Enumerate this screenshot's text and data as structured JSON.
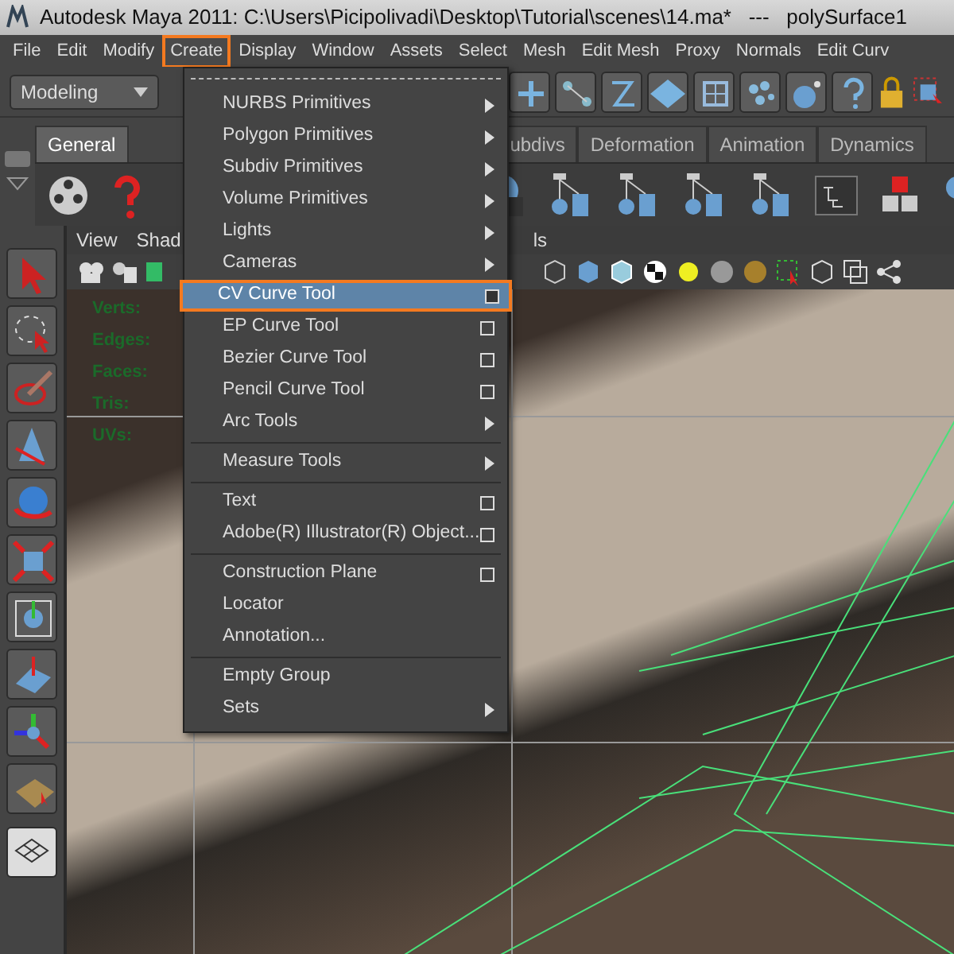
{
  "window": {
    "title": "Autodesk Maya 2011: C:\\Users\\Picipolivadi\\Desktop\\Tutorial\\scenes\\14.ma*   ---   polySurface1"
  },
  "menu_bar": [
    {
      "label": "File",
      "selected": false
    },
    {
      "label": "Edit",
      "selected": false
    },
    {
      "label": "Modify",
      "selected": false
    },
    {
      "label": "Create",
      "selected": true
    },
    {
      "label": "Display",
      "selected": false
    },
    {
      "label": "Window",
      "selected": false
    },
    {
      "label": "Assets",
      "selected": false
    },
    {
      "label": "Select",
      "selected": false
    },
    {
      "label": "Mesh",
      "selected": false
    },
    {
      "label": "Edit Mesh",
      "selected": false
    },
    {
      "label": "Proxy",
      "selected": false
    },
    {
      "label": "Normals",
      "selected": false
    },
    {
      "label": "Edit Curv",
      "selected": false
    }
  ],
  "status_line": {
    "menu_set": "Modeling"
  },
  "shelf_tabs": [
    {
      "label": "General",
      "selected": true
    },
    {
      "label": "ubdivs",
      "selected": false
    },
    {
      "label": "Deformation",
      "selected": false
    },
    {
      "label": "Animation",
      "selected": false
    },
    {
      "label": "Dynamics",
      "selected": false
    }
  ],
  "viewport": {
    "menus": [
      "View",
      "Shad",
      "ls"
    ],
    "heads_up": [
      "Verts:",
      "Edges:",
      "Faces:",
      "Tris:",
      "UVs:"
    ]
  },
  "create_menu": [
    {
      "label": "NURBS Primitives",
      "kind": "submenu",
      "selected": false,
      "divider_before": false
    },
    {
      "label": "Polygon Primitives",
      "kind": "submenu",
      "selected": false,
      "divider_before": false
    },
    {
      "label": "Subdiv Primitives",
      "kind": "submenu",
      "selected": false,
      "divider_before": false
    },
    {
      "label": "Volume Primitives",
      "kind": "submenu",
      "selected": false,
      "divider_before": false
    },
    {
      "label": "Lights",
      "kind": "submenu",
      "selected": false,
      "divider_before": false
    },
    {
      "label": "Cameras",
      "kind": "submenu",
      "selected": false,
      "divider_before": false
    },
    {
      "label": "CV Curve Tool",
      "kind": "option",
      "selected": true,
      "divider_before": false
    },
    {
      "label": "EP Curve Tool",
      "kind": "option",
      "selected": false,
      "divider_before": false
    },
    {
      "label": "Bezier Curve Tool",
      "kind": "option",
      "selected": false,
      "divider_before": false
    },
    {
      "label": "Pencil Curve Tool",
      "kind": "option",
      "selected": false,
      "divider_before": false
    },
    {
      "label": "Arc Tools",
      "kind": "submenu",
      "selected": false,
      "divider_before": false
    },
    {
      "label": "Measure Tools",
      "kind": "submenu",
      "selected": false,
      "divider_before": true
    },
    {
      "label": "Text",
      "kind": "option",
      "selected": false,
      "divider_before": true
    },
    {
      "label": "Adobe(R) Illustrator(R) Object...",
      "kind": "option",
      "selected": false,
      "divider_before": false
    },
    {
      "label": "Construction Plane",
      "kind": "option",
      "selected": false,
      "divider_before": true
    },
    {
      "label": "Locator",
      "kind": "plain",
      "selected": false,
      "divider_before": false
    },
    {
      "label": "Annotation...",
      "kind": "plain",
      "selected": false,
      "divider_before": false
    },
    {
      "label": "Empty Group",
      "kind": "plain",
      "selected": false,
      "divider_before": true
    },
    {
      "label": "Sets",
      "kind": "submenu",
      "selected": false,
      "divider_before": false
    }
  ]
}
